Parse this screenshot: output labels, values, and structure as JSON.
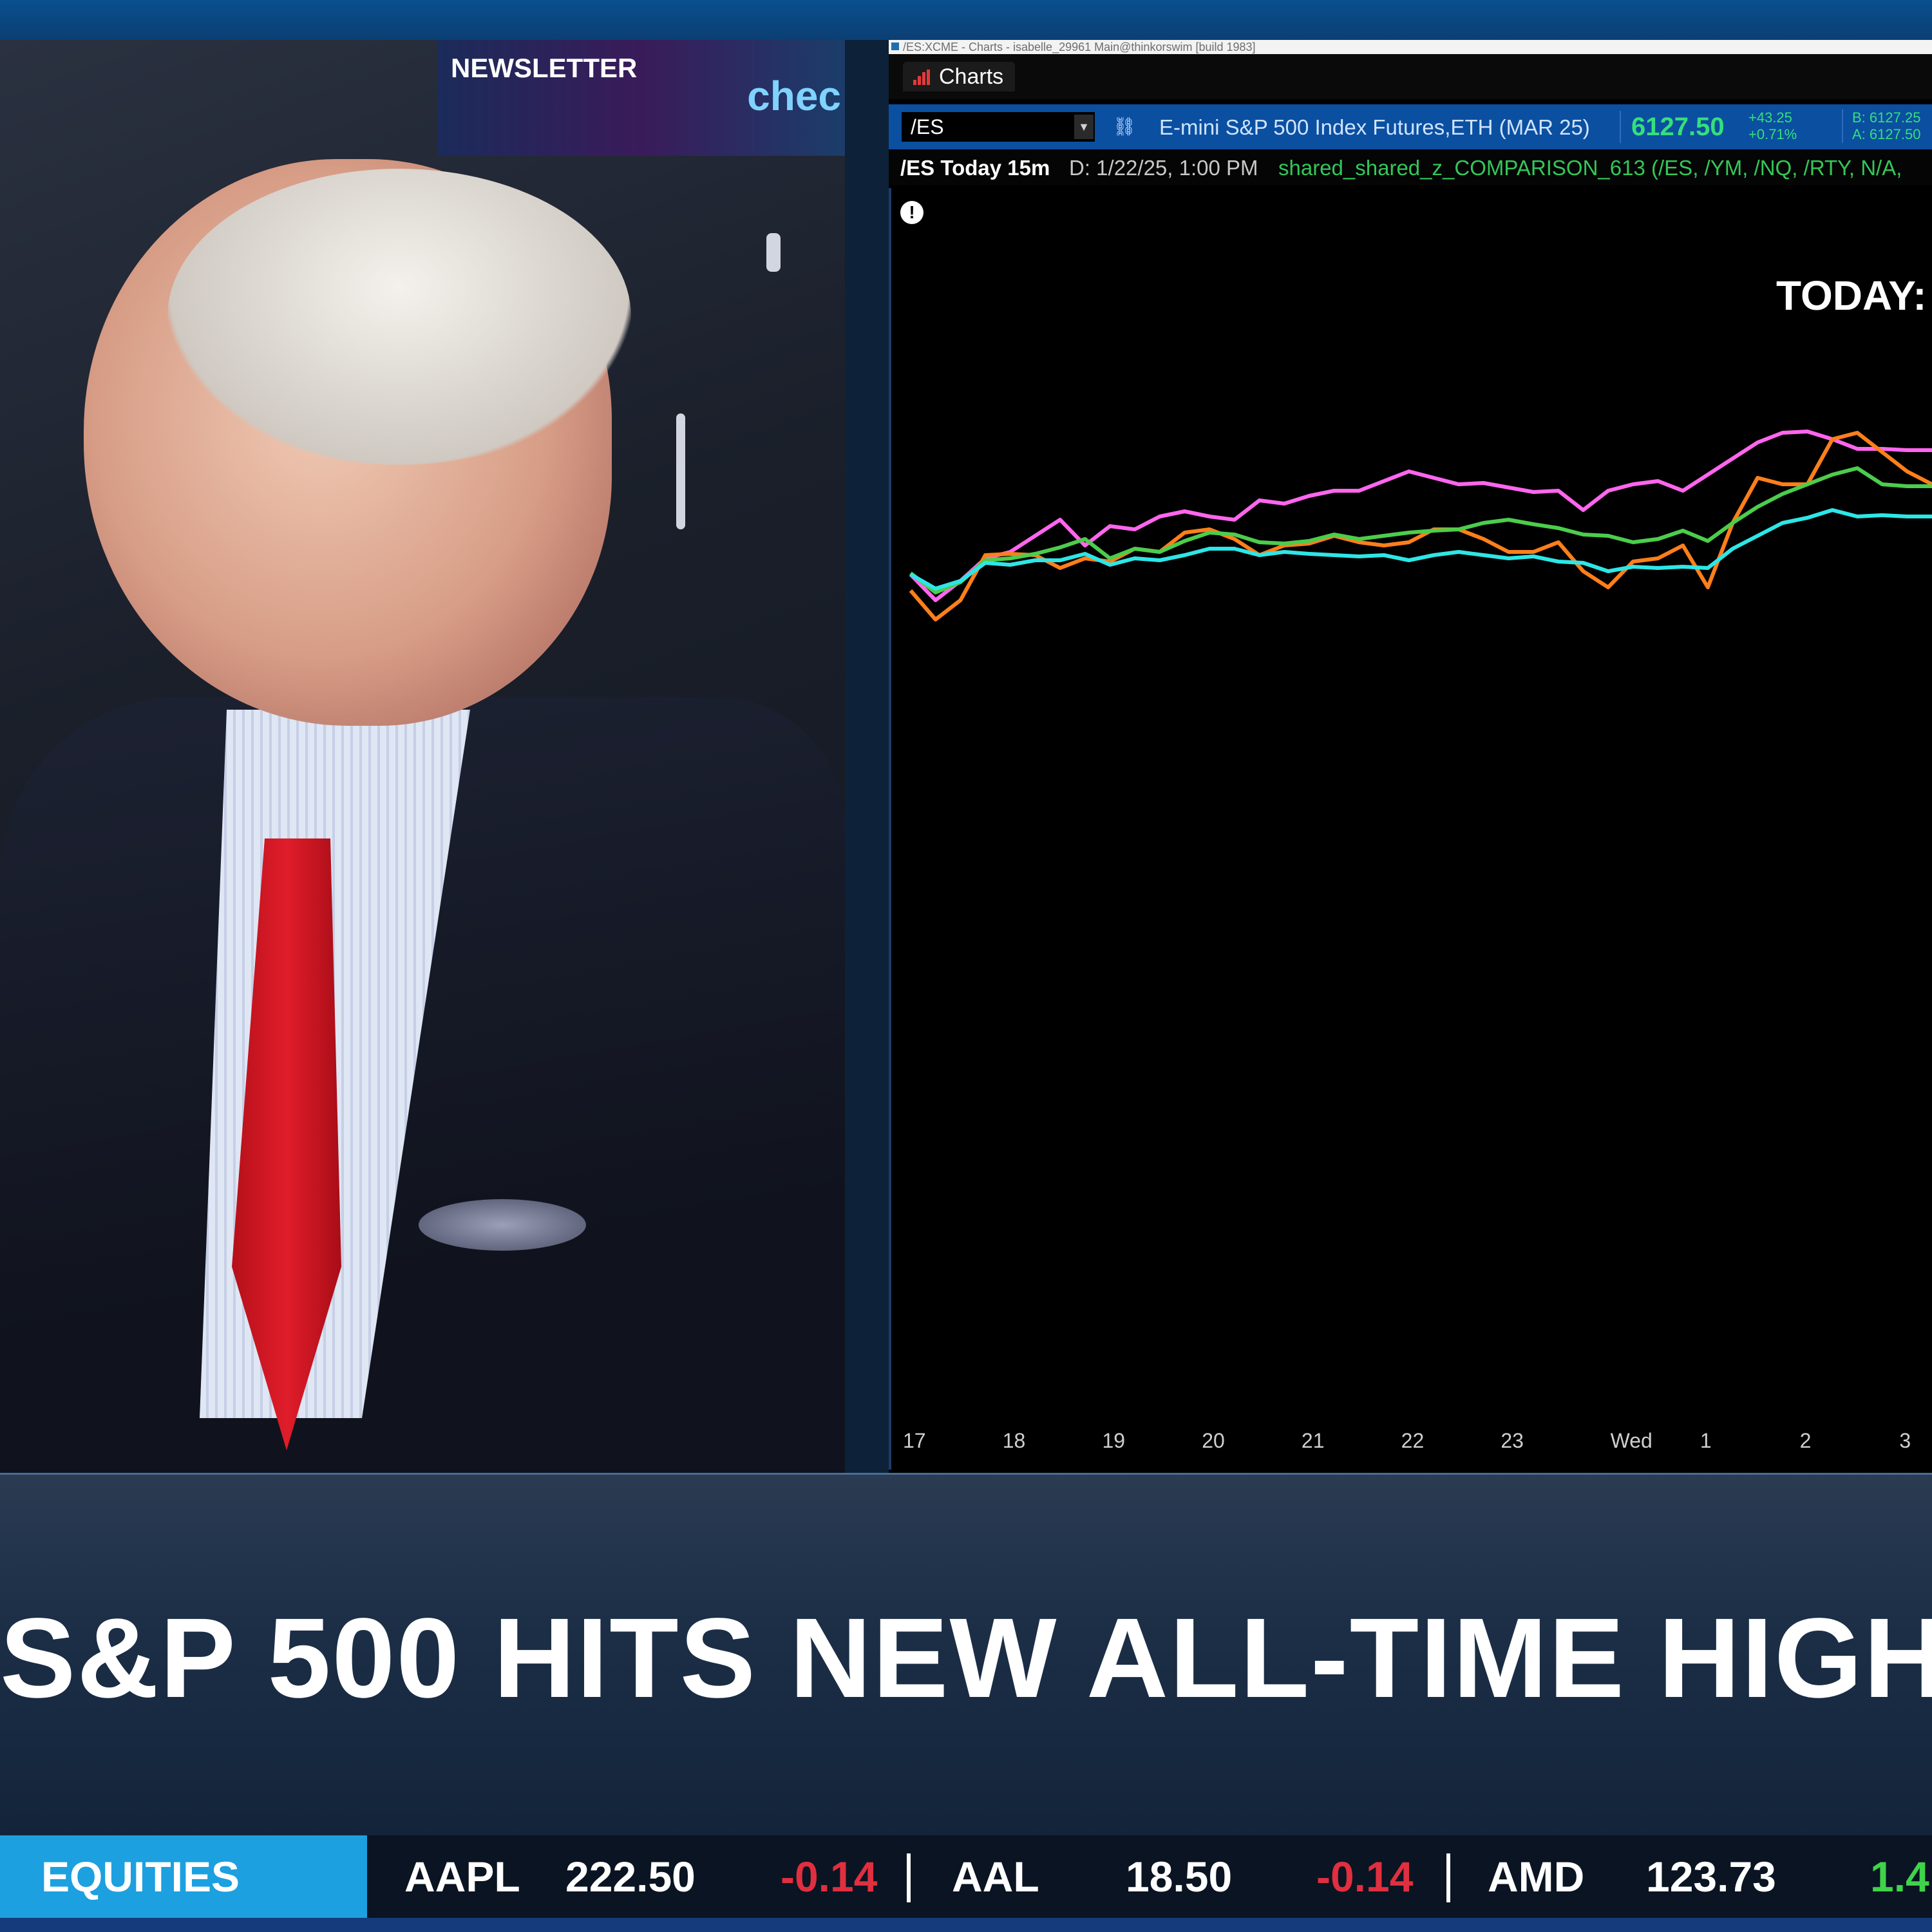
{
  "video": {
    "screen_text": "NEWSLETTER",
    "screen_logo": "chec"
  },
  "chart_window": {
    "title_bar": "/ES:XCME - Charts - isabelle_29961 Main@thinkorswim [build 1983]",
    "tab_label": "Charts",
    "symbol_input": "/ES",
    "symbol_description": "E-mini S&P 500 Index Futures,ETH (MAR 25)",
    "last_price": "6127.50",
    "net_change": "+43.25",
    "pct_change": "+0.71%",
    "bid": "B: 6127.25",
    "ask": "A: 6127.50",
    "chart_label": "/ES Today 15m",
    "chart_date": "D: 1/22/25, 1:00 PM",
    "study_label": "shared_shared_z_COMPARISON_613 (/ES, /YM, /NQ, /RTY, N/A,",
    "alert_icon": "!",
    "overlay_title": "TODAY:",
    "colors": {
      "accent": "#0b4fa0",
      "positive": "#34e07a",
      "negative": "#e02f3f"
    }
  },
  "chart_data": {
    "type": "line",
    "x_tick_labels": [
      "17",
      "18",
      "19",
      "20",
      "21",
      "22",
      "23",
      "Wed",
      "1",
      "2",
      "3"
    ],
    "x": [
      17.0,
      17.25,
      17.5,
      17.75,
      18.0,
      18.25,
      18.5,
      18.75,
      19.0,
      19.25,
      19.5,
      19.75,
      20.0,
      20.25,
      20.5,
      20.75,
      21.0,
      21.25,
      21.5,
      21.75,
      22.0,
      22.25,
      22.5,
      22.75,
      23.0,
      23.25,
      23.5,
      23.75,
      24.0,
      24.25,
      24.5,
      24.75,
      25.0,
      25.25,
      25.5,
      25.75,
      26.0,
      26.25,
      26.5,
      26.75,
      27.0,
      27.25
    ],
    "series": [
      {
        "color": "#ff66ee",
        "values": [
          830,
          870,
          840,
          805,
          795,
          770,
          745,
          785,
          755,
          760,
          740,
          732,
          740,
          745,
          715,
          720,
          708,
          700,
          700,
          685,
          670,
          680,
          690,
          688,
          695,
          702,
          700,
          730,
          700,
          690,
          685,
          700,
          675,
          650,
          625,
          610,
          608,
          620,
          635,
          635,
          637,
          637
        ]
      },
      {
        "color": "#ff7f1a",
        "values": [
          855,
          900,
          870,
          800,
          798,
          800,
          820,
          805,
          810,
          790,
          795,
          765,
          760,
          775,
          800,
          785,
          782,
          770,
          780,
          785,
          780,
          760,
          760,
          775,
          795,
          795,
          780,
          825,
          850,
          810,
          805,
          785,
          850,
          750,
          680,
          690,
          690,
          620,
          610,
          640,
          670,
          690
        ]
      },
      {
        "color": "#4ccd4c",
        "values": [
          828,
          858,
          842,
          808,
          805,
          798,
          788,
          775,
          805,
          790,
          795,
          778,
          765,
          768,
          780,
          782,
          778,
          768,
          775,
          770,
          765,
          762,
          760,
          750,
          745,
          752,
          758,
          768,
          770,
          780,
          775,
          762,
          778,
          750,
          725,
          705,
          690,
          675,
          665,
          690,
          693,
          693
        ]
      },
      {
        "color": "#2ee6e6",
        "values": [
          830,
          852,
          840,
          812,
          815,
          808,
          808,
          798,
          815,
          805,
          808,
          800,
          790,
          790,
          800,
          795,
          798,
          800,
          802,
          800,
          808,
          800,
          795,
          800,
          805,
          802,
          810,
          812,
          825,
          818,
          820,
          818,
          820,
          790,
          770,
          750,
          742,
          730,
          740,
          738,
          740,
          740
        ]
      }
    ],
    "y_axis": "price-relative, unlabeled",
    "grid": false,
    "legend": "none"
  },
  "lower_third": {
    "headline": "S&P 500 HITS NEW ALL-TIME HIGH"
  },
  "ticker": {
    "category": "EQUITIES",
    "items": [
      {
        "symbol": "AAPL",
        "price": "222.50",
        "change": "-0.14",
        "direction": "down"
      },
      {
        "symbol": "AAL",
        "price": "18.50",
        "change": "-0.14",
        "direction": "down"
      },
      {
        "symbol": "AMD",
        "price": "123.73",
        "change": "1.4",
        "direction": "up"
      }
    ]
  }
}
